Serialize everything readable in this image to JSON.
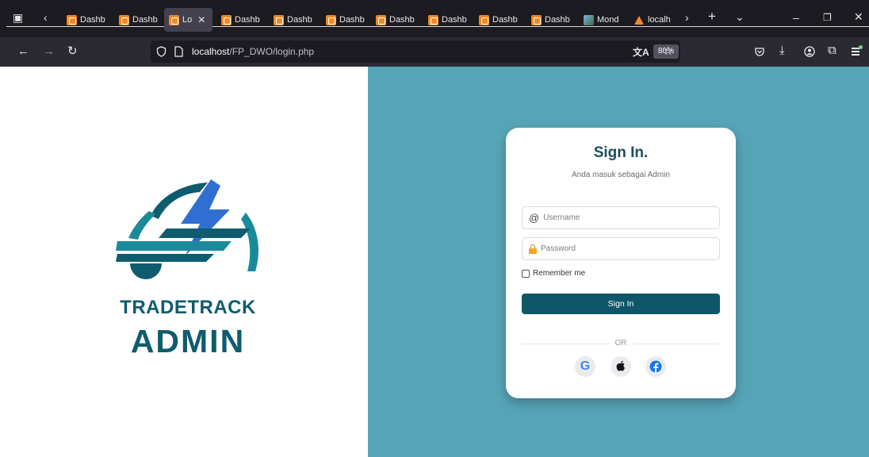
{
  "browser": {
    "tabs": [
      {
        "label": "Dashb",
        "icon": "xampp-favicon",
        "active": false
      },
      {
        "label": "Dashb",
        "icon": "xampp-favicon",
        "active": false
      },
      {
        "label": "Lo",
        "icon": "xampp-favicon",
        "active": true
      },
      {
        "label": "Dashb",
        "icon": "xampp-favicon",
        "active": false
      },
      {
        "label": "Dashb",
        "icon": "xampp-favicon",
        "active": false
      },
      {
        "label": "Dashb",
        "icon": "xampp-favicon",
        "active": false
      },
      {
        "label": "Dashb",
        "icon": "xampp-favicon",
        "active": false
      },
      {
        "label": "Dashb",
        "icon": "xampp-favicon",
        "active": false
      },
      {
        "label": "Dashb",
        "icon": "xampp-favicon",
        "active": false
      },
      {
        "label": "Dashb",
        "icon": "xampp-favicon",
        "active": false
      },
      {
        "label": "Mond",
        "icon": "image-favicon",
        "active": false
      },
      {
        "label": "localh",
        "icon": "xampp-logo-favicon",
        "active": false
      }
    ],
    "url_host": "localhost",
    "url_path": "/FP_DWO/login.php",
    "zoom": "80%"
  },
  "brand": {
    "line1": "TRADETRACK",
    "line2": "ADMIN",
    "colors": {
      "primary": "#0f5c6e",
      "accent": "#2f6fd1",
      "teal": "#1a8a9a"
    }
  },
  "login": {
    "title": "Sign In.",
    "subtitle": "Anda masuk sebagai Admin",
    "username_placeholder": "Username",
    "password_placeholder": "Password",
    "remember_label": "Remember me",
    "submit_label": "Sign In",
    "or_label": "OR",
    "social": [
      "google-icon",
      "apple-icon",
      "facebook-icon"
    ]
  },
  "colors": {
    "right_background": "#56a5b7",
    "button": "#0f5668",
    "title": "#1a4e5f"
  }
}
